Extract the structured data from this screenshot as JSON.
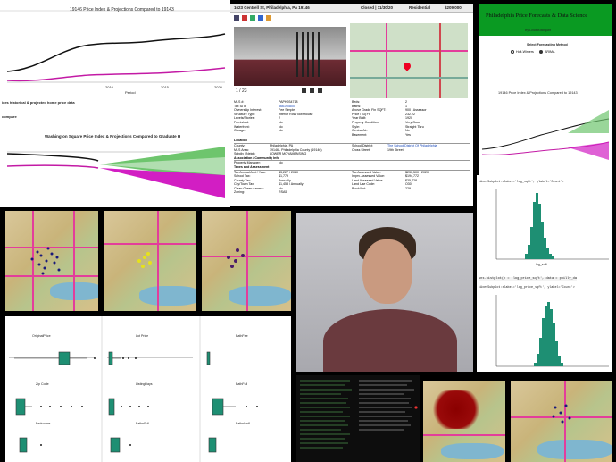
{
  "top_left": {
    "chart1_title": "19146 Price Index & Projections Compared to 19143",
    "chart1_xticks": [
      "2005",
      "2010",
      "2015",
      "2020"
    ],
    "chart1_xlabel": "Period",
    "label_a": "ices historical & projected home price data",
    "label_b": "compare",
    "chart2_title": "Washington Square Price Index & Projections Compared to Graduate H"
  },
  "listing": {
    "address": "1623 Centrell St, Philadelphia, PA 19146",
    "status": "Closed | 11/30/20",
    "type": "Residential",
    "price": "$209,000",
    "photo_counter": "1 / 23",
    "fields_left": [
      [
        "MLS #:",
        "PAPH934718"
      ],
      [
        "Tax ID #:",
        "366190800"
      ],
      [
        "Ownership Interest:",
        "Fee Simple"
      ],
      [
        "Structure Type:",
        "Interior Row/Townhouse"
      ],
      [
        "Levels/Stories:",
        "2"
      ],
      [
        "Furnished:",
        "No"
      ],
      [
        "Waterfront:",
        "No"
      ],
      [
        "Garage:",
        "No"
      ]
    ],
    "fields_right": [
      [
        "Beds:",
        "2"
      ],
      [
        "Baths:",
        "1"
      ],
      [
        "Above Grade Fin SQFT:",
        "900 / Assessor"
      ],
      [
        "Price / Sq Ft:",
        "232.22"
      ],
      [
        "Year Built:",
        "1920"
      ],
      [
        "Property Condition:",
        "Very Good"
      ],
      [
        "Style:",
        "Straight Thru"
      ],
      [
        "Central Air:",
        "No"
      ],
      [
        "Basement:",
        "Yes"
      ]
    ],
    "location_header": "Location",
    "location_left": [
      [
        "County:",
        "Philadelphia, PA"
      ],
      [
        "MLS Area:",
        "19146 - Philadelphia County (19146)"
      ],
      [
        "Subdiv / Neigh:",
        "LOWER MOYAMENSING"
      ]
    ],
    "location_right": [
      [
        "School District:",
        "The School District Of Philadelphia"
      ],
      [
        "Cross Street:",
        "19th Street"
      ]
    ],
    "assoc_header": "Association / Community Info",
    "assoc_left": [
      [
        "Property Manager:",
        "No"
      ]
    ],
    "taxes_header": "Taxes and Assessment",
    "taxes_left": [
      [
        "Tax Annual Amt / Year:",
        "$3,227 / 2020"
      ],
      [
        "School Tax:",
        "$1,779"
      ],
      [
        "County Tax:",
        "Annually"
      ],
      [
        "City/Town Tax:",
        "$1,458 / Annually"
      ],
      [
        "Clean Green Assess:",
        "No"
      ],
      [
        "Zoning:",
        "RSA5"
      ]
    ],
    "taxes_right": [
      [
        "Tax Assessed Value:",
        "$230,500 / 2020"
      ],
      [
        "Imprv. Assessed Value:",
        "$194,772"
      ],
      [
        "Land Assessed Value:",
        "$35,728"
      ],
      [
        "Land Use Code:",
        "O30"
      ],
      [
        "Block/Lot:",
        "229"
      ]
    ]
  },
  "forecast": {
    "title": "Philadelphia Price Forecasts & Data Science",
    "author": "By Louis Rodriguez",
    "control_label": "Select Forecasting Method",
    "option1": "Holt-Winters",
    "option2": "ARIMA",
    "chart_title": "19146 Price Index & Projections Compared to 19143"
  },
  "histograms": {
    "header1": "<AxesSubplot:xlabel='log_sqft', ylabel='Count'>",
    "code2": "sns.histplot(x = 'log_price_sqft', data = philly_da",
    "header2": "<AxesSubplot:xlabel='log_price_sqft', ylabel='Count'>",
    "xlabel1": "log_sqft",
    "ylabel": "Count",
    "xticks1": [
      "5",
      "6",
      "7",
      "8",
      "9",
      "10"
    ],
    "yticks1": [
      "3500",
      "3000",
      "2500",
      "2000",
      "1500",
      "1000",
      "500",
      "0"
    ],
    "yticks2": [
      "2500",
      "2000",
      "1500",
      "1000",
      "500",
      "0"
    ]
  },
  "boxplots": {
    "labels": [
      "OriginalPrice",
      "Lot Price",
      "BathFee",
      "Zip Code",
      "ListingDays",
      "BathFull",
      "Bedrooms",
      "BathsFull",
      "BathsHalf"
    ]
  },
  "colors": {
    "green": "#0e8a6a",
    "magenta": "#e33d9b",
    "forecast_bg": "#0a9a22"
  }
}
